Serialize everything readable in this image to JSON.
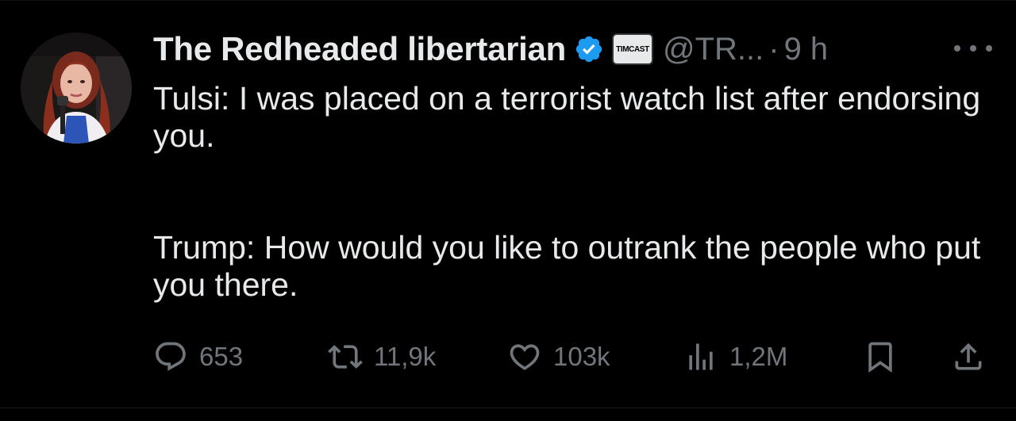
{
  "tweet": {
    "display_name": "The Redheaded libertarian",
    "affiliation_badge": "TIMCAST",
    "handle": "@TR...",
    "separator": "·",
    "time": "9 h",
    "paragraph_1": "Tulsi: I was placed on a terrorist watch list after endorsing you.",
    "paragraph_2": "Trump: How would you like to outrank the people who put you there."
  },
  "actions": {
    "replies": "653",
    "reposts": "11,9k",
    "likes": "103k",
    "views": "1,2M"
  },
  "icons": {
    "verified": "verified-badge-icon",
    "more": "more-icon",
    "reply": "reply-icon",
    "repost": "repost-icon",
    "like": "heart-icon",
    "views": "views-chart-icon",
    "bookmark": "bookmark-icon",
    "share": "share-icon"
  },
  "colors": {
    "background": "#000000",
    "text_primary": "#e7e9ea",
    "text_secondary": "#71767b",
    "verified_blue": "#1d9bf0"
  }
}
